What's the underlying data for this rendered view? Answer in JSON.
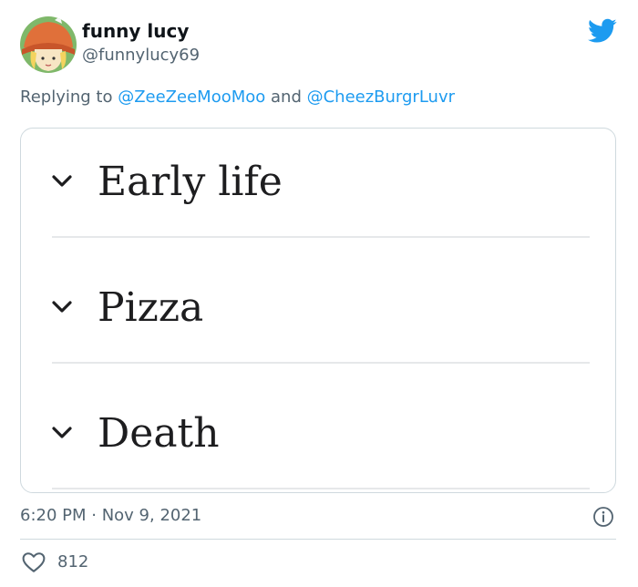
{
  "tweet": {
    "author": {
      "name": "funny lucy",
      "handle": "@funnylucy69",
      "avatar_icon": "cartoon-girl-avatar",
      "platform_icon": "twitter-bird-icon",
      "platform_color": "#1d9bf0"
    },
    "reply_prefix": "Replying to ",
    "mentions": [
      "@ZeeZeeMooMoo",
      "@CheezBurgrLuvr"
    ],
    "mention_joiner": " and ",
    "media": {
      "sections": [
        {
          "title": "Early life",
          "icon": "chevron-down-icon"
        },
        {
          "title": "Pizza",
          "icon": "chevron-down-icon"
        },
        {
          "title": "Death",
          "icon": "chevron-down-icon"
        }
      ]
    },
    "timestamp": "6:20 PM · Nov 9, 2021",
    "info_icon": "info-icon",
    "like_icon": "heart-icon",
    "likes": "812"
  }
}
